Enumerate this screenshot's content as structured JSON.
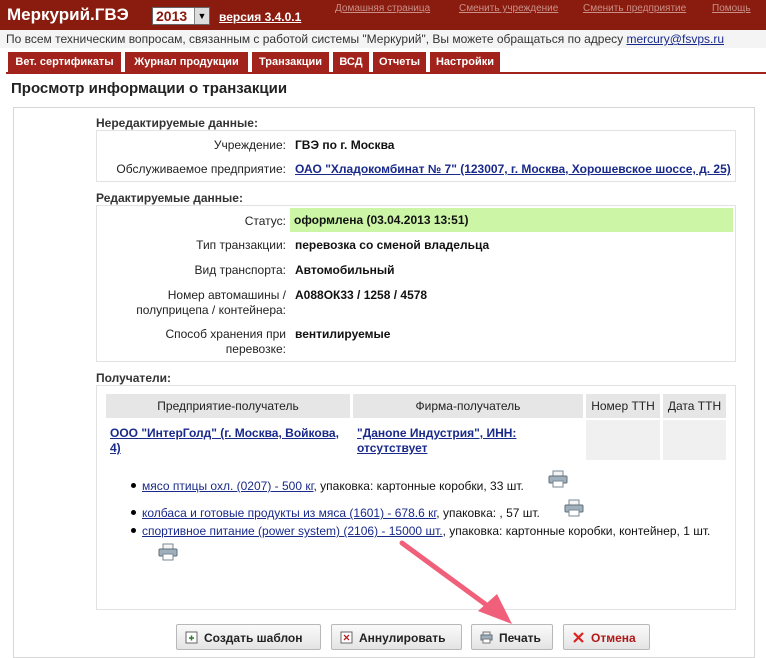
{
  "app": {
    "brand": "Меркурий.ГВЭ",
    "year": "2013",
    "version": "версия 3.4.0.1",
    "top_links": [
      "Домашняя страница",
      "Сменить учреждение",
      "Сменить предприятие",
      "Помощь"
    ]
  },
  "info": {
    "text": "По всем техническим вопросам, связанным с работой системы \"Меркурий\", Вы можете обращаться по адресу",
    "email": "mercury@fsvps.ru"
  },
  "menu": [
    "Вет. сертификаты",
    "Журнал продукции",
    "Транзакции",
    "ВСД",
    "Отчеты",
    "Настройки"
  ],
  "page": {
    "title": "Просмотр информации о транзакции"
  },
  "readonly": {
    "heading": "Нередактируемые данные:",
    "institution_label": "Учреждение:",
    "institution_value": "ГВЭ по г. Москва",
    "enterprise_label": "Обслуживаемое предприятие:",
    "enterprise_value": "ОАО \"Хладокомбинат № 7\" (123007, г. Москва, Хорошевское шоссе, д. 25)"
  },
  "editable": {
    "heading": "Редактируемые данные:",
    "status_label": "Статус:",
    "status_value": "оформлена (03.04.2013 13:51)",
    "type_label": "Тип транзакции:",
    "type_value": "перевозка со сменой владельца",
    "transport_label": "Вид транспорта:",
    "transport_value": "Автомобильный",
    "vehicle_label_1": "Номер автомашины /",
    "vehicle_label_2": "полуприцепа / контейнера:",
    "vehicle_value": "А088ОК33 / 1258 / 4578",
    "storage_label_1": "Способ хранения при",
    "storage_label_2": "перевозке:",
    "storage_value": "вентилируемые"
  },
  "recipients": {
    "heading": "Получатели:",
    "columns": [
      "Предприятие-получатель",
      "Фирма-получатель",
      "Номер ТТН",
      "Дата ТТН"
    ],
    "row": {
      "enterprise_1": "ООО \"ИнтерГолд\" (г. Москва, Войкова,",
      "enterprise_2": "4)",
      "firm_1": "\"Данone Индустрия\", ИНН:",
      "firm_2": "отсутствует",
      "ttn_number": "",
      "ttn_date": ""
    },
    "items": [
      {
        "link": "мясо птицы охл. (0207) - 500 кг",
        "rest": ", упаковка: картонные коробки, 33 шт."
      },
      {
        "link": "колбаса и готовые продукты из мяса (1601) - 678.6 кг",
        "rest": ", упаковка: , 57 шт."
      },
      {
        "link": "спортивное питание (power system) (2106) - 15000 шт.",
        "rest": ", упаковка: картонные коробки, контейнер, 1 шт."
      }
    ]
  },
  "buttons": {
    "template": "Создать шаблон",
    "cancel_tx": "Аннулировать",
    "print": "Печать",
    "cancel": "Отмена"
  },
  "colors": {
    "brand": "#8a1c0f",
    "menu": "#a2231b",
    "status_bg": "#ccf5a6",
    "link": "#1a2a8a",
    "arrow": "#f0607a"
  }
}
